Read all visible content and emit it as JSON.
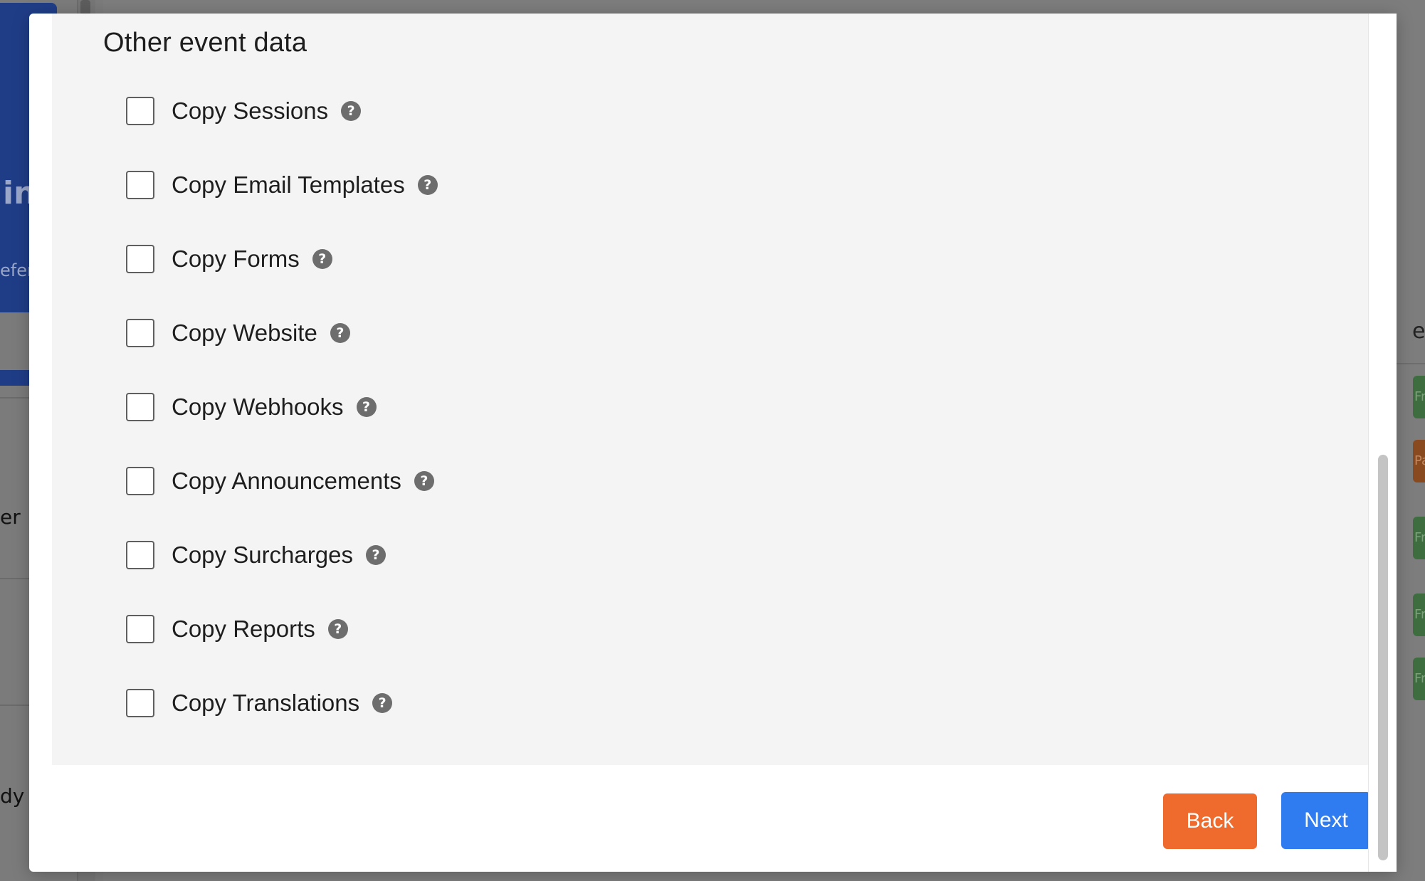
{
  "background": {
    "banner_partial_heading": "in",
    "banner_partial_subtext": "efer",
    "list_partial_1": "er",
    "list_partial_2": "dy",
    "right_partial_text": "e",
    "right_pills": [
      {
        "label": "Fr",
        "color": "#3e6e3f"
      },
      {
        "label": "Pa",
        "color": "#8a4a20"
      },
      {
        "label": "Fr",
        "color": "#3e6e3f"
      },
      {
        "label": "Fr",
        "color": "#3e6e3f"
      },
      {
        "label": "Fr",
        "color": "#3e6e3f"
      }
    ]
  },
  "modal": {
    "section_title": "Other event data",
    "options": [
      {
        "label": "Copy Sessions",
        "checked": false,
        "help_icon": "question-circle-icon"
      },
      {
        "label": "Copy Email Templates",
        "checked": false,
        "help_icon": "question-circle-icon"
      },
      {
        "label": "Copy Forms",
        "checked": false,
        "help_icon": "question-circle-icon"
      },
      {
        "label": "Copy Website",
        "checked": false,
        "help_icon": "question-circle-icon"
      },
      {
        "label": "Copy Webhooks",
        "checked": false,
        "help_icon": "question-circle-icon"
      },
      {
        "label": "Copy Announcements",
        "checked": false,
        "help_icon": "question-circle-icon"
      },
      {
        "label": "Copy Surcharges",
        "checked": false,
        "help_icon": "question-circle-icon"
      },
      {
        "label": "Copy Reports",
        "checked": false,
        "help_icon": "question-circle-icon"
      },
      {
        "label": "Copy Translations",
        "checked": false,
        "help_icon": "question-circle-icon"
      }
    ],
    "help_glyph": "?",
    "back_label": "Back",
    "next_label": "Next"
  },
  "colors": {
    "back_button": "#ee6a2d",
    "next_button": "#2f7bf0",
    "section_background": "#f4f4f4",
    "overlay": "#7d7d7d"
  }
}
